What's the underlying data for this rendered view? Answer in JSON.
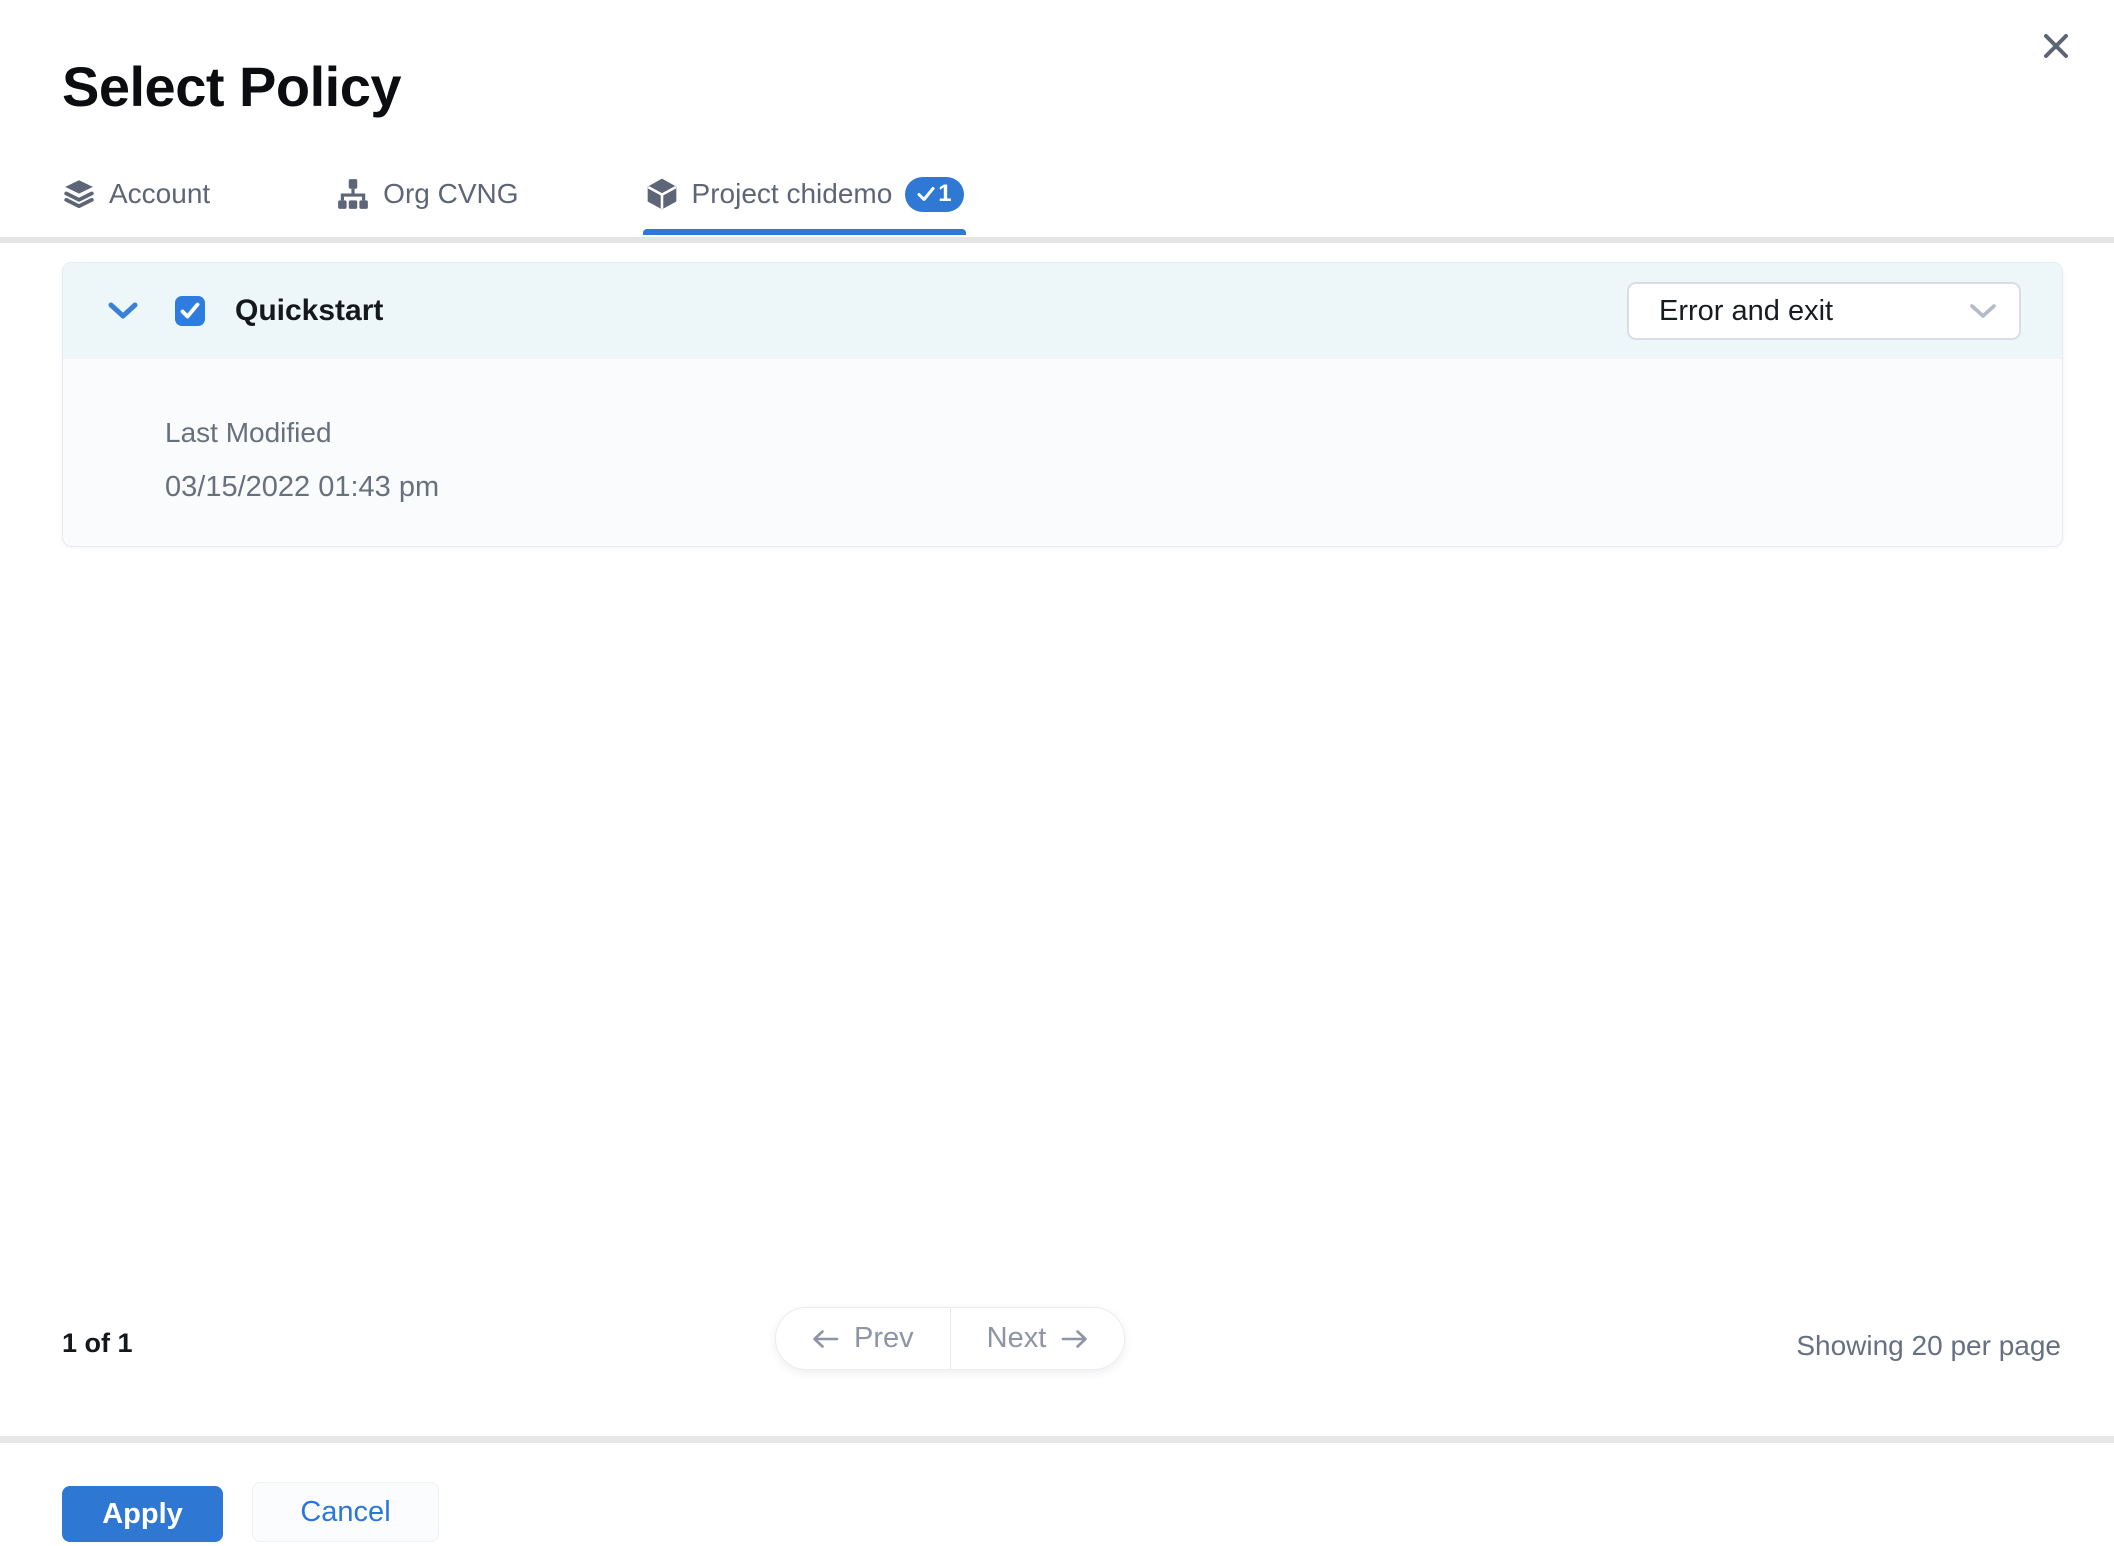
{
  "modal": {
    "title": "Select Policy"
  },
  "tabs": [
    {
      "label": "Account",
      "icon": "layers-icon",
      "active": false
    },
    {
      "label": "Org CVNG",
      "icon": "org-tree-icon",
      "active": false
    },
    {
      "label": "Project chidemo",
      "icon": "cube-icon",
      "active": true,
      "badge": {
        "check": "✓",
        "count": "1"
      }
    }
  ],
  "policy": {
    "name": "Quickstart",
    "checked": true,
    "action": {
      "value": "Error and exit"
    },
    "details": {
      "label": "Last Modified",
      "value": "03/15/2022 01:43 pm"
    }
  },
  "pagination": {
    "summary": "1 of 1",
    "prev_label": "Prev",
    "next_label": "Next",
    "prev_arrow": "←",
    "next_arrow": "→",
    "per_page": "Showing 20 per page"
  },
  "footer": {
    "apply_label": "Apply",
    "cancel_label": "Cancel"
  },
  "icons": {
    "close": "close-icon (×)",
    "account": "layers-icon",
    "org": "org-tree-icon",
    "project": "cube-icon",
    "badge_check": "check-icon",
    "row_expand": "chevron-down-icon",
    "select_open": "chevron-down-icon"
  },
  "colors": {
    "accent_blue": "#2f78d4",
    "checkbox_blue": "#2e7ce0",
    "apply_blue": "#2e77d2",
    "cancel_text_blue": "#2b76d9",
    "card_header_bg": "#edf7fa",
    "card_body_bg": "#fafbfd",
    "divider_gray": "#e4e4e5",
    "slate_text": "#5d6577",
    "muted_text": "#68707e",
    "pager_text": "#8e94a6"
  }
}
